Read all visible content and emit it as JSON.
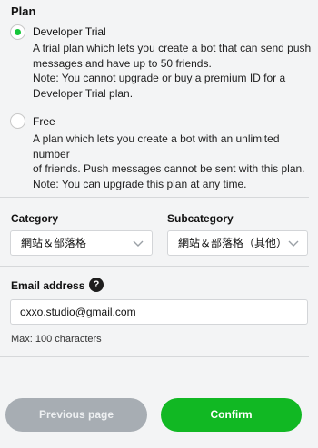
{
  "plan": {
    "title": "Plan",
    "options": [
      {
        "label": "Developer Trial",
        "selected": true,
        "description": [
          "A trial plan which lets you create a bot that can send push",
          "messages and have up to 50 friends.",
          "Note: You cannot upgrade or buy a premium ID for a",
          "Developer Trial plan."
        ]
      },
      {
        "label": "Free",
        "selected": false,
        "description": [
          "A plan which lets you create a bot with an unlimited number",
          "of friends. Push messages cannot be sent with this plan.",
          "Note: You can upgrade this plan at any time."
        ]
      }
    ]
  },
  "category": {
    "label": "Category",
    "value": "網站＆部落格"
  },
  "subcategory": {
    "label": "Subcategory",
    "value": "網站＆部落格（其他）"
  },
  "email": {
    "label": "Email address",
    "help": "?",
    "value": "oxxo.studio@gmail.com",
    "hint": "Max: 100 characters"
  },
  "buttons": {
    "previous": "Previous page",
    "confirm": "Confirm"
  },
  "colors": {
    "accent": "#11b823",
    "radio_dot": "#15c63a",
    "disabled_button": "#a7adb3",
    "background": "#f3f4f5"
  },
  "icons": {
    "select_arrow": "chevron-down-icon",
    "help": "question-mark-icon"
  }
}
